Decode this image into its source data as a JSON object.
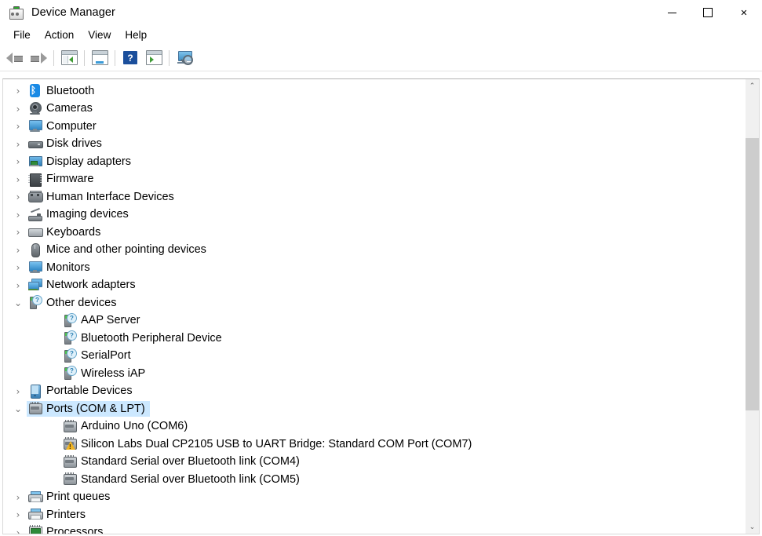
{
  "window": {
    "title": "Device Manager",
    "app_icon": "device-manager-icon",
    "controls": {
      "minimize": "Minimize",
      "maximize": "Maximize",
      "close": "Close"
    }
  },
  "menubar": {
    "items": [
      {
        "label": "File"
      },
      {
        "label": "Action"
      },
      {
        "label": "View"
      },
      {
        "label": "Help"
      }
    ]
  },
  "toolbar": {
    "buttons": [
      {
        "name": "back-button",
        "icon": "back-arrow-icon",
        "tooltip": "Back"
      },
      {
        "name": "forward-button",
        "icon": "forward-arrow-icon",
        "tooltip": "Forward"
      },
      {
        "name": "show-hide-console-tree-button",
        "icon": "console-tree-icon",
        "tooltip": "Show/Hide Console Tree"
      },
      {
        "name": "properties-button",
        "icon": "properties-icon",
        "tooltip": "Properties"
      },
      {
        "name": "help-button",
        "icon": "help-icon",
        "tooltip": "Help"
      },
      {
        "name": "update-driver-button",
        "icon": "update-driver-icon",
        "tooltip": "Update Driver Software"
      },
      {
        "name": "scan-for-hardware-changes-button",
        "icon": "scan-hardware-icon",
        "tooltip": "Scan for hardware changes"
      }
    ]
  },
  "tree": {
    "rows": [
      {
        "label": "Bluetooth",
        "level": 1,
        "state": "collapsed",
        "icon": "bluetooth-icon",
        "selected": false
      },
      {
        "label": "Cameras",
        "level": 1,
        "state": "collapsed",
        "icon": "camera-icon",
        "selected": false
      },
      {
        "label": "Computer",
        "level": 1,
        "state": "collapsed",
        "icon": "monitor-icon",
        "selected": false
      },
      {
        "label": "Disk drives",
        "level": 1,
        "state": "collapsed",
        "icon": "disk-drive-icon",
        "selected": false
      },
      {
        "label": "Display adapters",
        "level": 1,
        "state": "collapsed",
        "icon": "display-adapter-icon",
        "selected": false
      },
      {
        "label": "Firmware",
        "level": 1,
        "state": "collapsed",
        "icon": "firmware-chip-icon",
        "selected": false
      },
      {
        "label": "Human Interface Devices",
        "level": 1,
        "state": "collapsed",
        "icon": "hid-gamepad-icon",
        "selected": false
      },
      {
        "label": "Imaging devices",
        "level": 1,
        "state": "collapsed",
        "icon": "imaging-device-icon",
        "selected": false
      },
      {
        "label": "Keyboards",
        "level": 1,
        "state": "collapsed",
        "icon": "keyboard-icon",
        "selected": false
      },
      {
        "label": "Mice and other pointing devices",
        "level": 1,
        "state": "collapsed",
        "icon": "mouse-icon",
        "selected": false
      },
      {
        "label": "Monitors",
        "level": 1,
        "state": "collapsed",
        "icon": "monitor-icon",
        "selected": false
      },
      {
        "label": "Network adapters",
        "level": 1,
        "state": "collapsed",
        "icon": "network-adapter-icon",
        "selected": false
      },
      {
        "label": "Other devices",
        "level": 1,
        "state": "expanded",
        "icon": "unknown-device-icon",
        "selected": false
      },
      {
        "label": "AAP Server",
        "level": 2,
        "state": "leaf",
        "icon": "unknown-device-icon",
        "selected": false
      },
      {
        "label": "Bluetooth Peripheral Device",
        "level": 2,
        "state": "leaf",
        "icon": "unknown-device-icon",
        "selected": false
      },
      {
        "label": "SerialPort",
        "level": 2,
        "state": "leaf",
        "icon": "unknown-device-icon",
        "selected": false
      },
      {
        "label": "Wireless iAP",
        "level": 2,
        "state": "leaf",
        "icon": "unknown-device-icon",
        "selected": false
      },
      {
        "label": "Portable Devices",
        "level": 1,
        "state": "collapsed",
        "icon": "portable-device-icon",
        "selected": false
      },
      {
        "label": "Ports (COM & LPT)",
        "level": 1,
        "state": "expanded",
        "icon": "port-icon",
        "selected": true
      },
      {
        "label": "Arduino Uno (COM6)",
        "level": 2,
        "state": "leaf",
        "icon": "port-icon",
        "selected": false
      },
      {
        "label": "Silicon Labs Dual CP2105 USB to UART Bridge: Standard COM Port (COM7)",
        "level": 2,
        "state": "leaf",
        "icon": "port-warning-icon",
        "selected": false
      },
      {
        "label": "Standard Serial over Bluetooth link (COM4)",
        "level": 2,
        "state": "leaf",
        "icon": "port-icon",
        "selected": false
      },
      {
        "label": "Standard Serial over Bluetooth link (COM5)",
        "level": 2,
        "state": "leaf",
        "icon": "port-icon",
        "selected": false
      },
      {
        "label": "Print queues",
        "level": 1,
        "state": "collapsed",
        "icon": "printer-icon",
        "selected": false
      },
      {
        "label": "Printers",
        "level": 1,
        "state": "collapsed",
        "icon": "printer-icon",
        "selected": false
      },
      {
        "label": "Processors",
        "level": 1,
        "state": "collapsed",
        "icon": "processor-icon",
        "selected": false
      }
    ],
    "chevron_collapsed": "›",
    "chevron_expanded": "⌄"
  },
  "scrollbar": {
    "up_arrow": "⌃",
    "down_arrow": "⌄",
    "thumb_top_pct": 10,
    "thumb_height_pct": 60
  },
  "colors": {
    "selection": "#cce8ff",
    "warning": "#f0b323",
    "accent": "#1a8ae5"
  }
}
